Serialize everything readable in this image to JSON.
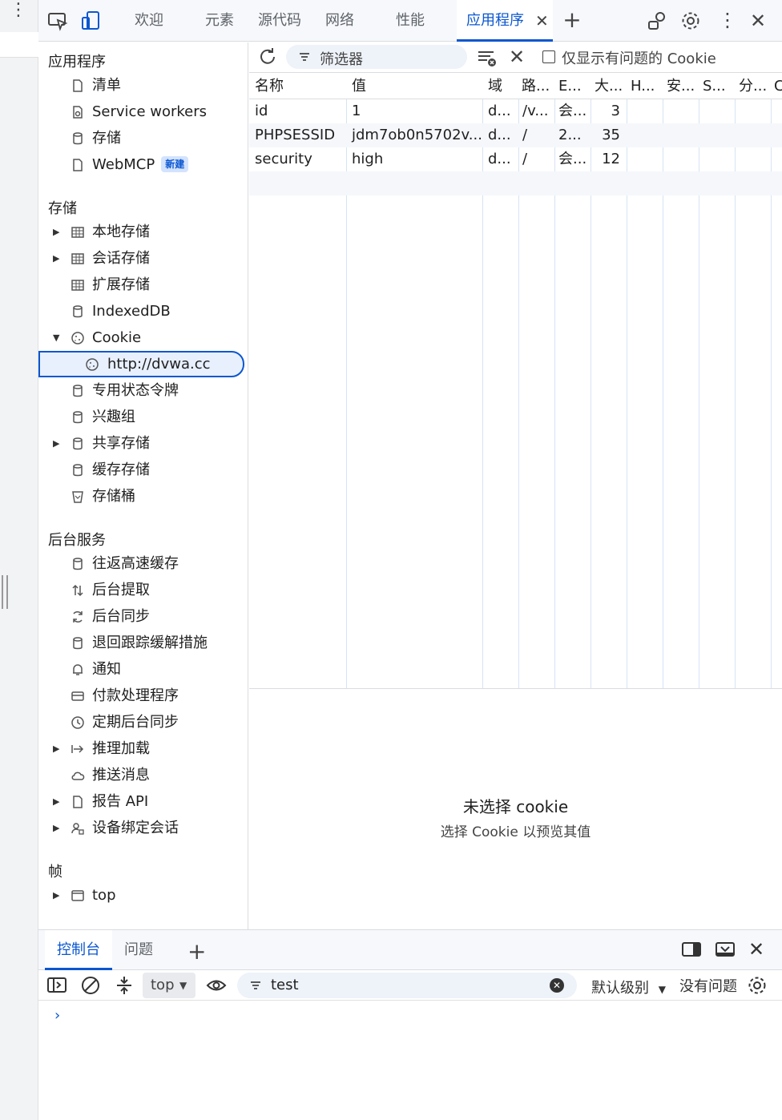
{
  "topbar": {
    "tabs": [
      "欢迎",
      "元素",
      "源代码",
      "网络",
      "性能",
      "应用程序"
    ],
    "active_tab": "应用程序"
  },
  "sidebar": {
    "app_title": "应用程序",
    "app_items": [
      {
        "label": "清单"
      },
      {
        "label": "Service workers"
      },
      {
        "label": "存储"
      },
      {
        "label": "WebMCP",
        "badge": "新建"
      }
    ],
    "storage_title": "存储",
    "storage_items": [
      {
        "label": "本地存储"
      },
      {
        "label": "会话存储"
      },
      {
        "label": "扩展存储"
      },
      {
        "label": "IndexedDB"
      },
      {
        "label": "Cookie"
      },
      {
        "label": "http://dvwa.cc"
      },
      {
        "label": "专用状态令牌"
      },
      {
        "label": "兴趣组"
      },
      {
        "label": "共享存储"
      },
      {
        "label": "缓存存储"
      },
      {
        "label": "存储桶"
      }
    ],
    "bg_title": "后台服务",
    "bg_items": [
      {
        "label": "往返高速缓存"
      },
      {
        "label": "后台提取"
      },
      {
        "label": "后台同步"
      },
      {
        "label": "退回跟踪缓解措施"
      },
      {
        "label": "通知"
      },
      {
        "label": "付款处理程序"
      },
      {
        "label": "定期后台同步"
      },
      {
        "label": "推理加载"
      },
      {
        "label": "推送消息"
      },
      {
        "label": "报告 API"
      },
      {
        "label": "设备绑定会话"
      }
    ],
    "frames_title": "帧",
    "frames_items": [
      {
        "label": "top"
      }
    ]
  },
  "toolbar": {
    "filter_placeholder": "筛选器",
    "only_issues_label": "仅显示有问题的 Cookie"
  },
  "table": {
    "headers": [
      "名称",
      "值",
      "域",
      "路...",
      "E...",
      "大...",
      "H...",
      "安...",
      "S...",
      "分...",
      "C"
    ],
    "rows": [
      [
        "id",
        "1",
        "d...",
        "/v...",
        "会...",
        "3"
      ],
      [
        "PHPSESSID",
        "jdm7ob0n5702v...",
        "d...",
        "/",
        "2...",
        "35"
      ],
      [
        "security",
        "high",
        "d...",
        "/",
        "会...",
        "12"
      ]
    ]
  },
  "preview": {
    "title": "未选择 cookie",
    "subtitle": "选择 Cookie 以预览其值"
  },
  "drawer": {
    "tabs": [
      "控制台",
      "问题"
    ],
    "context": "top",
    "filter_value": "test",
    "level_label": "默认级别",
    "issues_label": "没有问题",
    "prompt": "›"
  }
}
